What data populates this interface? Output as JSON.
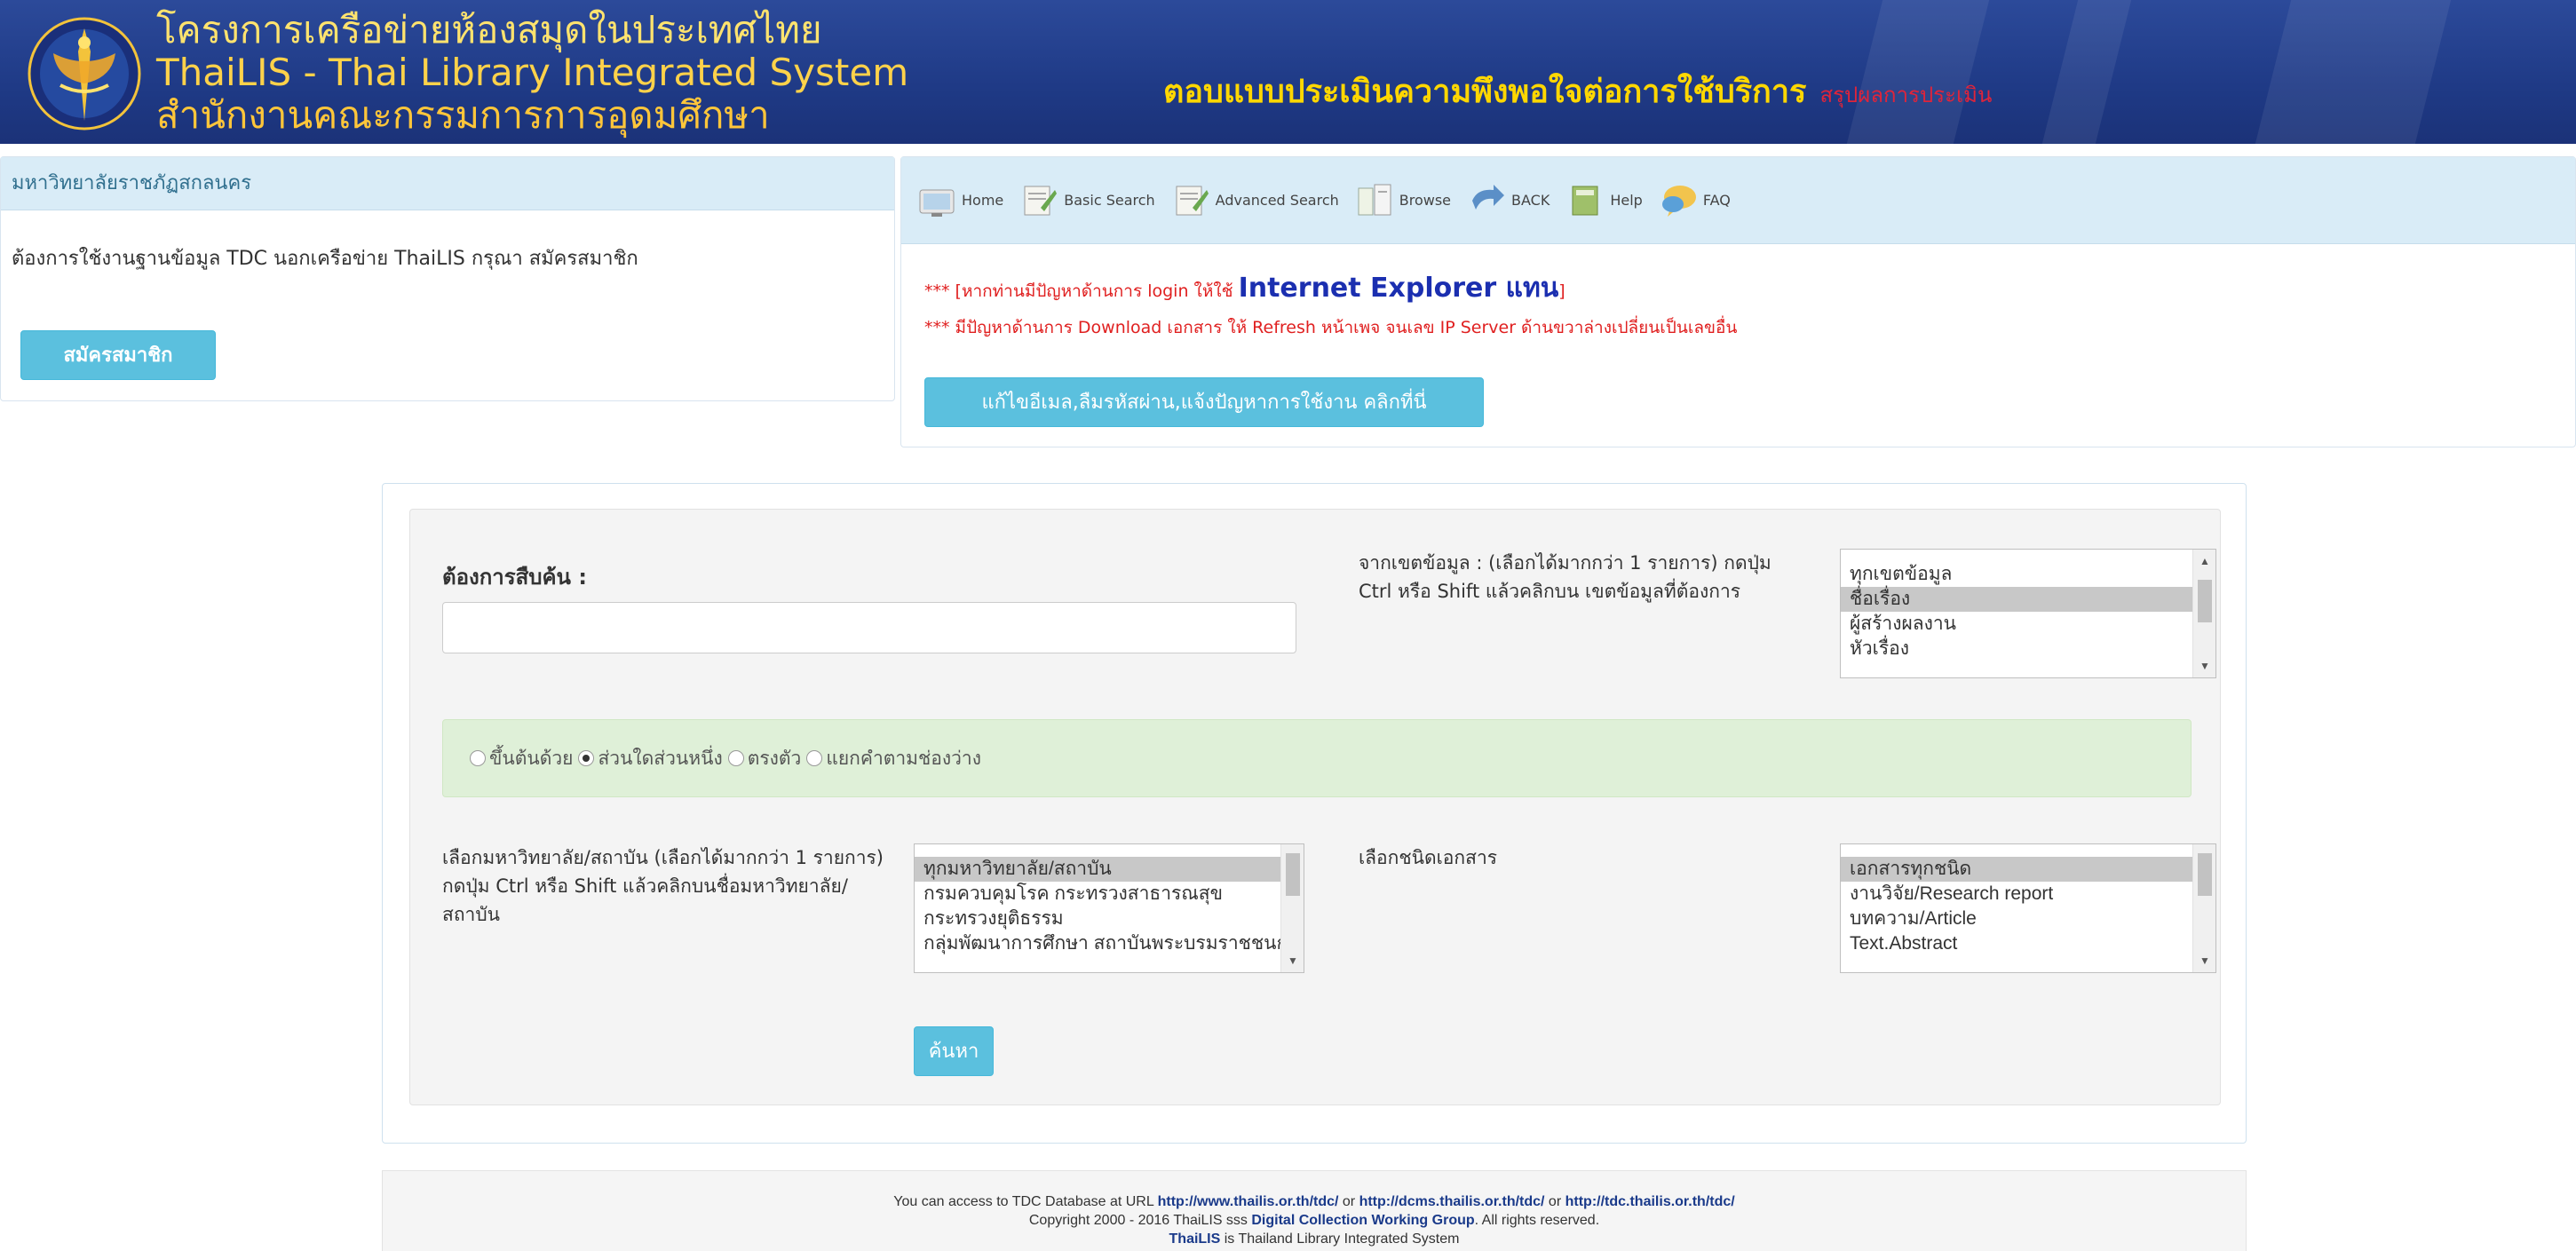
{
  "header": {
    "line1": "โครงการเครือข่ายห้องสมุดในประเทศไทย",
    "line2": "ThaiLIS - Thai Library Integrated System",
    "line3": "สำนักงานคณะกรรมการการอุดมศึกษา",
    "survey_title": "ตอบแบบประเมินความพึงพอใจต่อการใช้บริการ",
    "survey_result": "สรุปผลการประเมิน",
    "colors": {
      "background": "#1f3a86",
      "survey_title": "#ffd700",
      "survey_result": "#e0243a"
    }
  },
  "left_panel": {
    "university": "มหาวิทยาลัยราชภัฏสกลนคร",
    "message": "ต้องการใช้งานฐานข้อมูล TDC นอกเครือข่าย ThaiLIS กรุณา สมัครสมาชิก",
    "register_button": "สมัครสมาชิก"
  },
  "nav": {
    "items": [
      {
        "label": "Home",
        "icon": "home-icon"
      },
      {
        "label": "Basic Search",
        "icon": "basic-search-icon"
      },
      {
        "label": "Advanced Search",
        "icon": "advanced-search-icon"
      },
      {
        "label": "Browse",
        "icon": "browse-icon"
      },
      {
        "label": "BACK",
        "icon": "back-icon"
      },
      {
        "label": "Help",
        "icon": "help-icon"
      },
      {
        "label": "FAQ",
        "icon": "faq-icon"
      }
    ]
  },
  "notices": {
    "line1_prefix": "*** [หากท่านมีปัญหาด้านการ login ให้ใช้",
    "line1_highlight": "Internet Explorer แทน",
    "line1_suffix": "]",
    "line2": "*** มีปัญหาด้านการ Download เอกสาร ให้ Refresh หน้าเพจ จนเลข IP Server ด้านขวาล่างเปลี่ยนเป็นเลขอื่น"
  },
  "edit_button": "แก้ไขอีเมล,ลืมรหัสผ่าน,แจ้งปัญหาการใช้งาน คลิกที่นี่",
  "search": {
    "label": "ต้องการสืบค้น :",
    "input_value": "",
    "field_help": "จากเขตข้อมูล : (เลือกได้มากกว่า 1 รายการ) กดปุ่ม Ctrl หรือ Shift แล้วคลิกบน เขตข้อมูลที่ต้องการ",
    "fields": [
      "ทุกเขตข้อมูล",
      "ชื่อเรื่อง",
      "ผู้สร้างผลงาน",
      "หัวเรื่อง"
    ],
    "fields_selected": 1,
    "match_options": [
      {
        "label": "ขึ้นต้นด้วย",
        "checked": false
      },
      {
        "label": "ส่วนใดส่วนหนึ่ง",
        "checked": true
      },
      {
        "label": "ตรงตัว",
        "checked": false
      },
      {
        "label": "แยกคำตามช่องว่าง",
        "checked": false
      }
    ],
    "institution_help": "เลือกมหาวิทยาลัย/สถาบัน (เลือกได้มากกว่า 1 รายการ) กดปุ่ม Ctrl หรือ Shift แล้วคลิกบนชื่อมหาวิทยาลัย/สถาบัน",
    "institutions": [
      "ทุกมหาวิทยาลัย/สถาบัน",
      "กรมควบคุมโรค กระทรวงสาธารณสุข",
      "กระทรวงยุติธรรม",
      "กลุ่มพัฒนาการศึกษา สถาบันพระบรมราชชนก"
    ],
    "institutions_selected": 0,
    "doctype_label": "เลือกชนิดเอกสาร",
    "doctypes": [
      "เอกสารทุกชนิด",
      "งานวิจัย/Research report",
      "บทความ/Article",
      "Text.Abstract"
    ],
    "doctypes_selected": 0,
    "search_button": "ค้นหา"
  },
  "footer": {
    "l1_a": "You can access to TDC Database at URL ",
    "url1": "http://www.thailis.or.th/tdc/",
    "or1": " or ",
    "url2": "http://dcms.thailis.or.th/tdc/",
    "or2": " or ",
    "url3": "http://tdc.thailis.or.th/tdc/",
    "l2_a": "Copyright 2000 - 2016 ThaiLIS sss ",
    "l2_b": "Digital Collection Working Group",
    "l2_c": ". All rights reserved.",
    "l3_a": "ThaiLIS",
    "l3_b": " is Thailand Library Integrated System"
  }
}
